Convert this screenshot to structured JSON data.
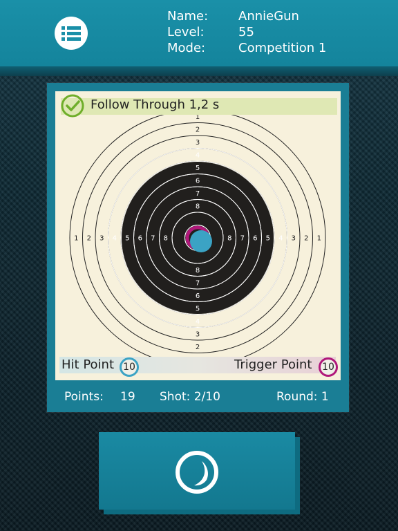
{
  "header": {
    "labels": {
      "name": "Name:",
      "level": "Level:",
      "mode": "Mode:"
    },
    "values": {
      "name": "AnnieGun",
      "level": "55",
      "mode": "Competition 1"
    },
    "menu_icon": "list-menu-icon"
  },
  "status": {
    "text": "Follow Through 1,2 s",
    "icon": "check-circle-icon"
  },
  "target": {
    "ring_numbers": [
      "1",
      "2",
      "3",
      "4",
      "5",
      "6",
      "7",
      "8"
    ],
    "hit_point": {
      "label": "Hit Point",
      "value": "10"
    },
    "trigger_point": {
      "label": "Trigger Point",
      "value": "10"
    }
  },
  "stats": {
    "points_label": "Points:",
    "points_value": "19",
    "shot": "Shot: 2/10",
    "round": "Round: 1"
  },
  "fire_button": {
    "icon": "fire-shot-icon"
  },
  "colors": {
    "header": "#1a90a8",
    "panel": "#1a7e95",
    "card": "#f7f1dc",
    "target_black": "#211f1d",
    "hit": "#3ba3c4",
    "trigger": "#b0187a",
    "status_banner": "#dfe8b4"
  }
}
